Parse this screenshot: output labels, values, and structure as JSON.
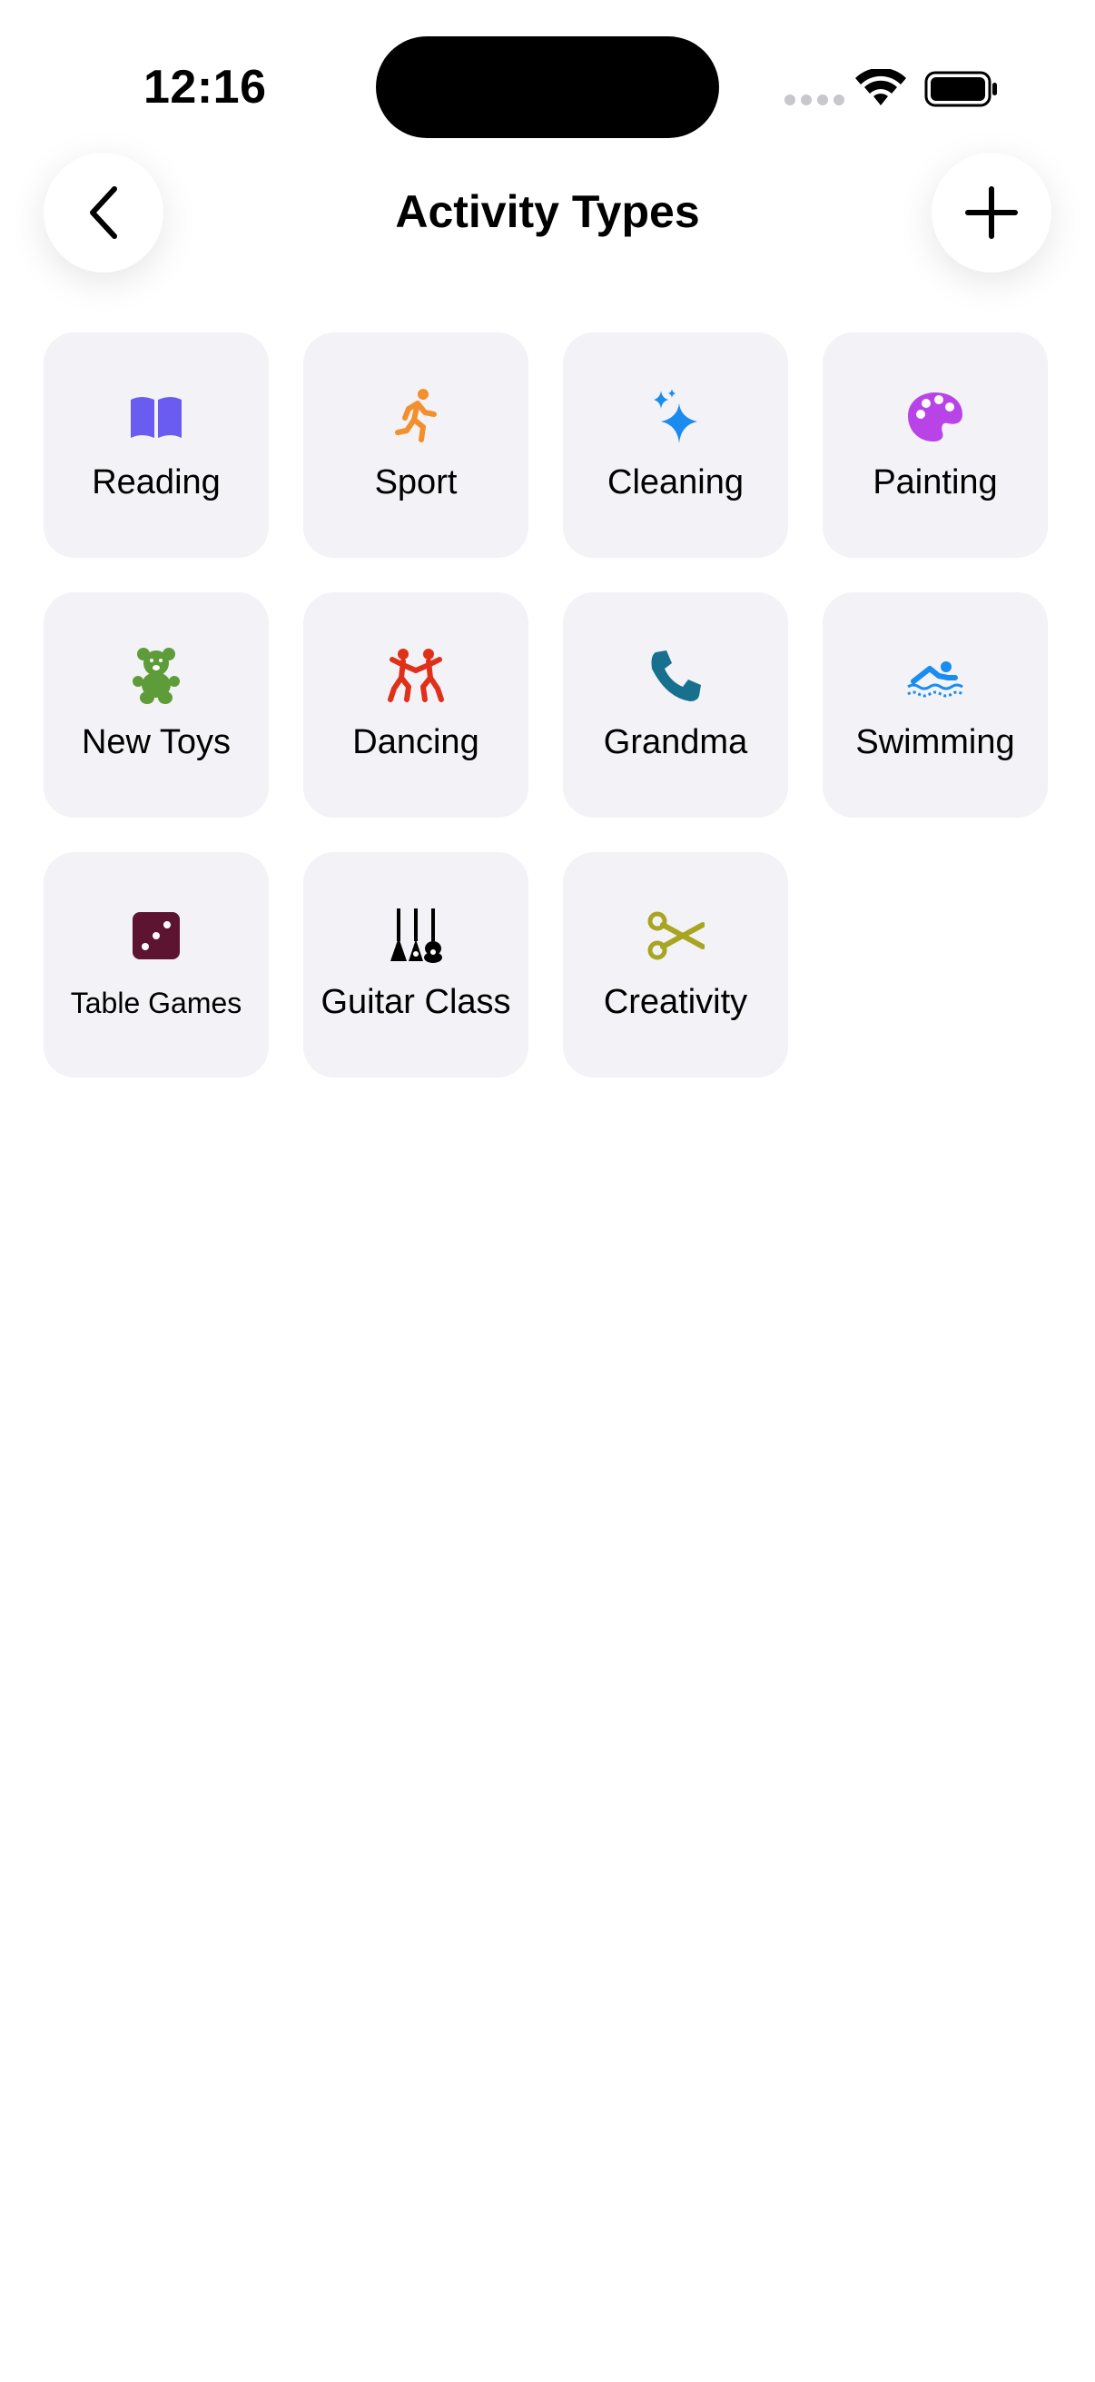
{
  "status_bar": {
    "time": "12:16"
  },
  "header": {
    "title": "Activity Types"
  },
  "activities": [
    {
      "label": "Reading",
      "icon": "book-icon",
      "color": "#6a5cf0"
    },
    {
      "label": "Sport",
      "icon": "running-figure-icon",
      "color": "#f2902e"
    },
    {
      "label": "Cleaning",
      "icon": "sparkles-icon",
      "color": "#1a8cf0"
    },
    {
      "label": "Painting",
      "icon": "palette-icon",
      "color": "#b844e8"
    },
    {
      "label": "New Toys",
      "icon": "teddy-bear-icon",
      "color": "#5e9c3a"
    },
    {
      "label": "Dancing",
      "icon": "dancing-figures-icon",
      "color": "#e0301a"
    },
    {
      "label": "Grandma",
      "icon": "phone-icon",
      "color": "#17708e"
    },
    {
      "label": "Swimming",
      "icon": "swimmer-icon",
      "color": "#1a8cf0"
    },
    {
      "label": "Table Games",
      "icon": "die-icon",
      "color": "#5c1430"
    },
    {
      "label": "Guitar Class",
      "icon": "guitars-icon",
      "color": "#000000"
    },
    {
      "label": "Creativity",
      "icon": "scissors-icon",
      "color": "#a8a520"
    }
  ]
}
